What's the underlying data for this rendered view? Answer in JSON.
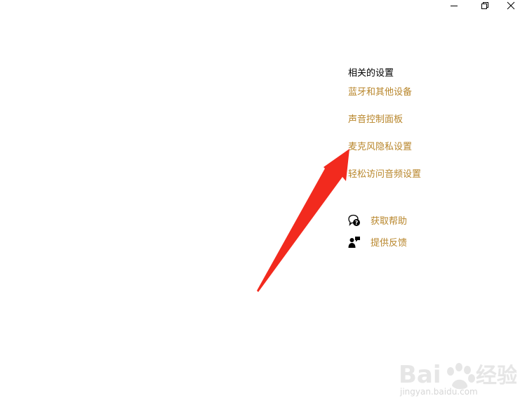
{
  "window": {
    "minimize_icon": "minimize-icon",
    "restore_icon": "restore-icon",
    "close_icon": "close-icon"
  },
  "related_settings": {
    "title": "相关的设置",
    "links": [
      "蓝牙和其他设备",
      "声音控制面板",
      "麦克风隐私设置",
      "轻松访问音频设置"
    ]
  },
  "help": {
    "get_help": "获取帮助",
    "give_feedback": "提供反馈"
  },
  "annotation": {
    "arrow_color": "#f22a1e"
  },
  "colors": {
    "link": "#b8862b",
    "text": "#000000",
    "background": "#ffffff"
  },
  "watermark": {
    "url": "jingyan.baidu.com"
  }
}
